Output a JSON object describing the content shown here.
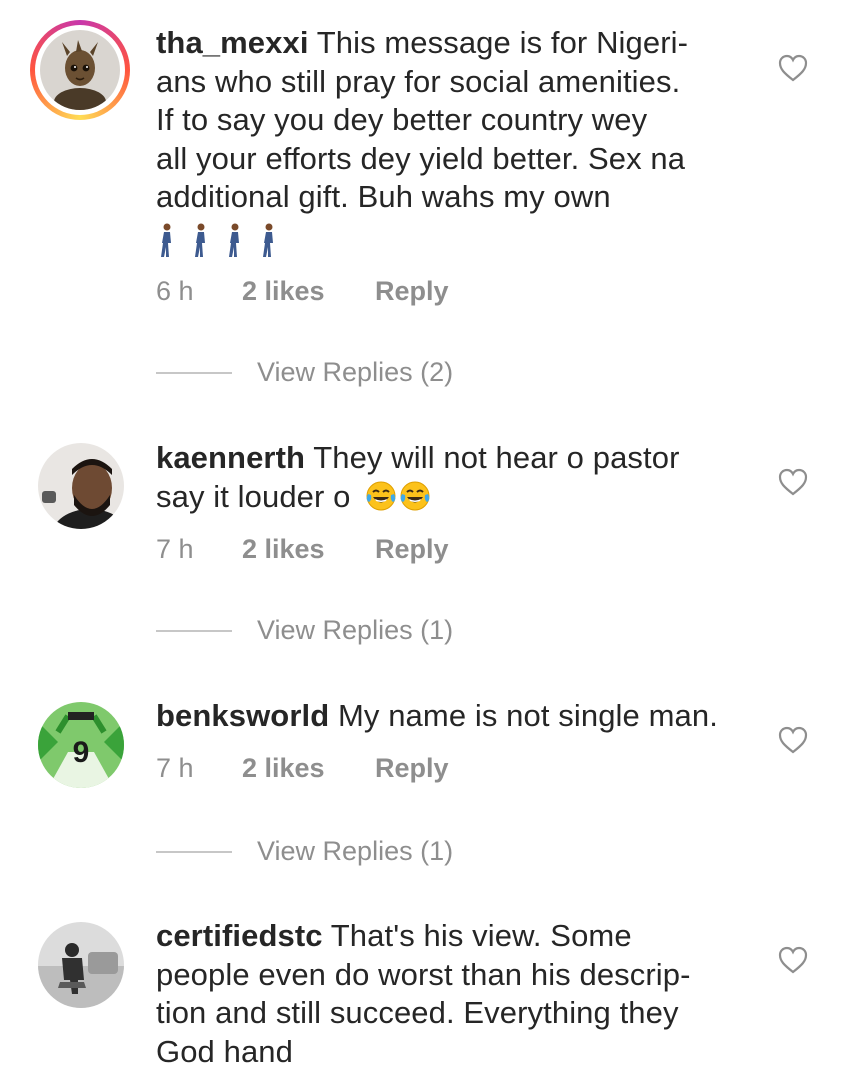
{
  "comments": [
    {
      "username": "tha_mexxi",
      "lines": [
        "This message is for Nigeri-",
        "ans who still pray for social amenities.",
        "If to say you dey better country wey",
        "all your efforts dey yield better. Sex na",
        "additional gift. Buh wahs my own"
      ],
      "emoji": [
        "person-walking-emoji",
        "person-walking-emoji",
        "person-walking-emoji",
        "person-walking-emoji"
      ],
      "time": "6 h",
      "likes": "2 likes",
      "reply": "Reply",
      "view_replies": "View Replies (2)"
    },
    {
      "username": "kaennerth",
      "lines": [
        "They will not hear o  pastor",
        "say it louder o"
      ],
      "emoji": [
        "tears-of-joy-emoji",
        "tears-of-joy-emoji"
      ],
      "time": "7 h",
      "likes": "2 likes",
      "reply": "Reply",
      "view_replies": "View Replies (1)"
    },
    {
      "username": "benksworld",
      "lines": [
        "My name is not single man."
      ],
      "time": "7 h",
      "likes": "2 likes",
      "reply": "Reply",
      "view_replies": "View Replies (1)"
    },
    {
      "username": "certifiedstc",
      "lines": [
        "That's his view. Some",
        "people even do worst than his descrip-",
        "tion and still succeed. Everything they",
        "God hand"
      ]
    }
  ],
  "colors": {
    "text": "#262626",
    "muted": "#8e8e8e",
    "divider": "#c7c7c7",
    "story_ring": [
      "#c837ab",
      "#ff543e",
      "#ffdd55"
    ]
  },
  "icons": {
    "like": "heart-outline-icon"
  }
}
